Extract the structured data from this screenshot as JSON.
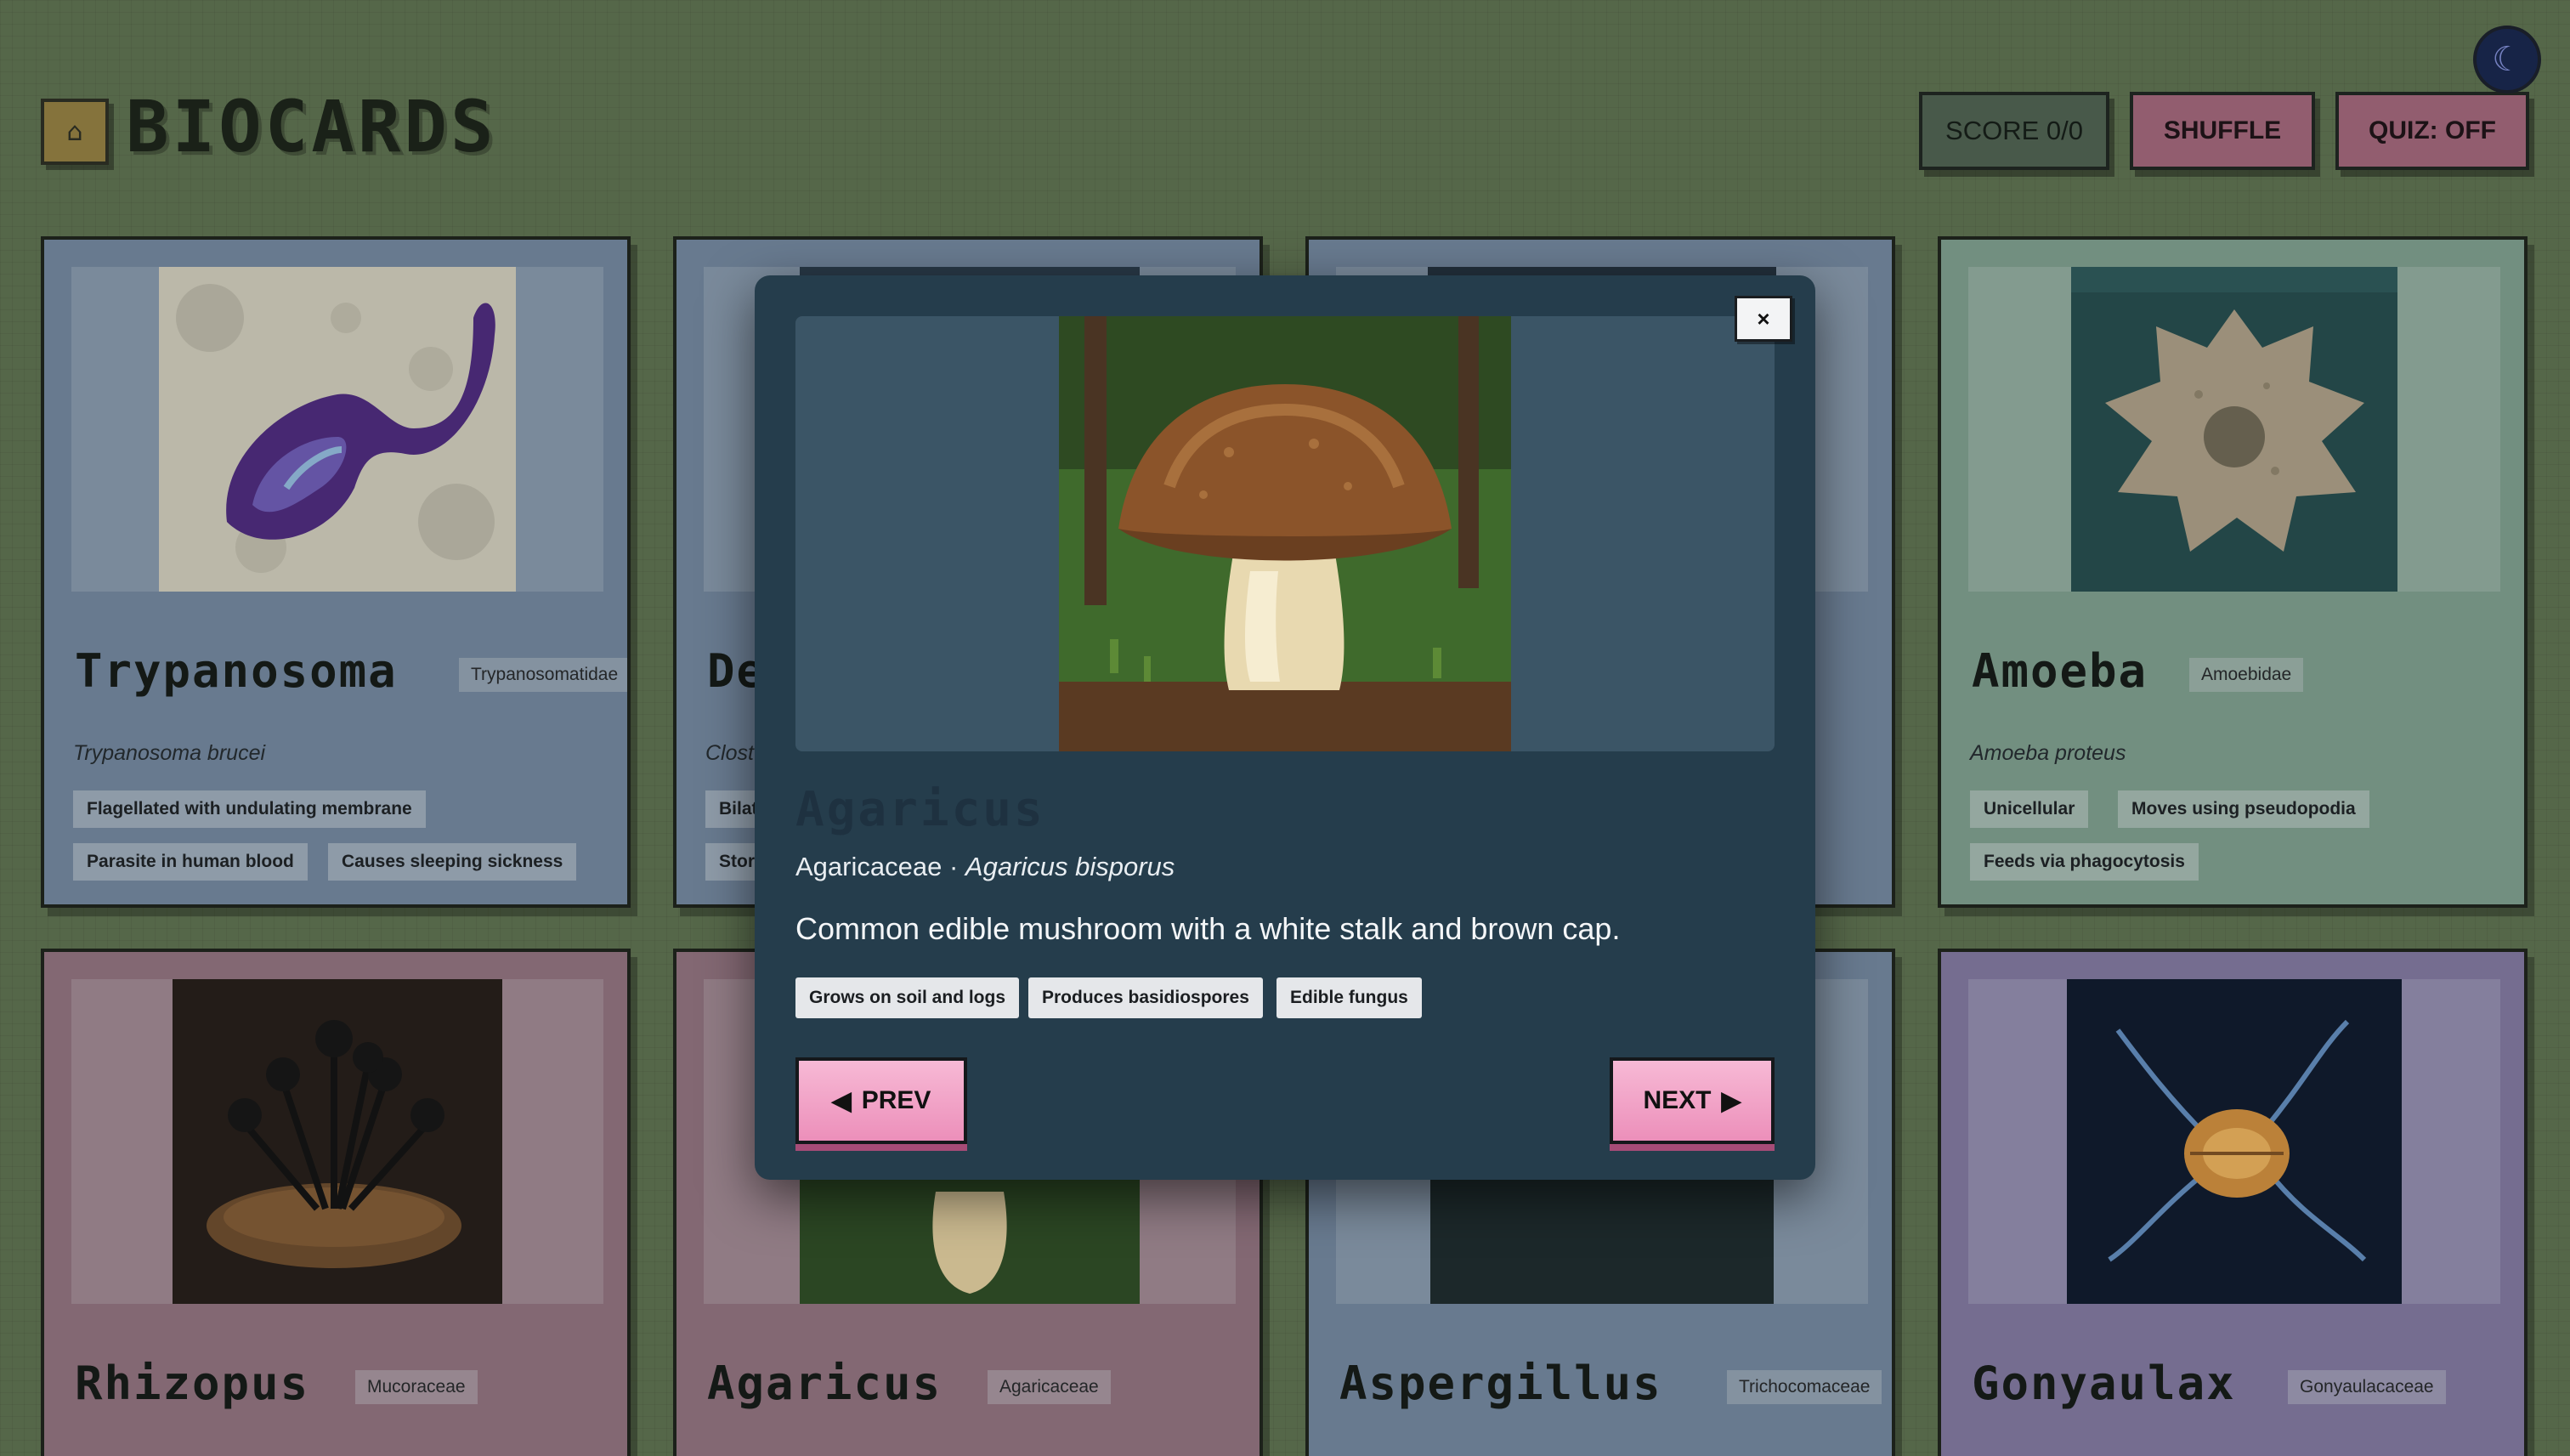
{
  "header": {
    "logo_icon": "home-icon",
    "brand": "BIOCARDS",
    "score_label": "SCORE 0/0",
    "shuffle_label": "SHUFFLE",
    "quiz_label": "QUIZ: OFF",
    "theme_toggle_icon": "moon-icon"
  },
  "cards": [
    {
      "title": "Trypanosoma",
      "family": "Trypanosomatidae",
      "species": "Trypanosoma brucei",
      "traits": [
        "Flagellated with undulating membrane",
        "Parasite in human blood",
        "Causes sleeping sickness"
      ]
    },
    {
      "title": "De",
      "species": "Clost",
      "traits": [
        "Bilat",
        "Stor"
      ]
    },
    {
      "title": "",
      "species": "",
      "traits": []
    },
    {
      "title": "Amoeba",
      "family": "Amoebidae",
      "species": "Amoeba proteus",
      "traits": [
        "Unicellular",
        "Moves using pseudopodia",
        "Feeds via phagocytosis"
      ]
    },
    {
      "title": "Rhizopus",
      "family": "Mucoraceae"
    },
    {
      "title": "Agaricus",
      "family": "Agaricaceae"
    },
    {
      "title": "Aspergillus",
      "family": "Trichocomaceae"
    },
    {
      "title": "Gonyaulax",
      "family": "Gonyaulacaceae"
    }
  ],
  "modal": {
    "close_label": "×",
    "title": "Agaricus",
    "family": "Agaricaceae",
    "separator": " · ",
    "species": "Agaricus bisporus",
    "description": "Common edible mushroom with a white stalk and brown cap.",
    "traits": [
      "Grows on soil and logs",
      "Produces basidiospores",
      "Edible fungus"
    ],
    "prev_label": "PREV",
    "next_label": "NEXT"
  }
}
